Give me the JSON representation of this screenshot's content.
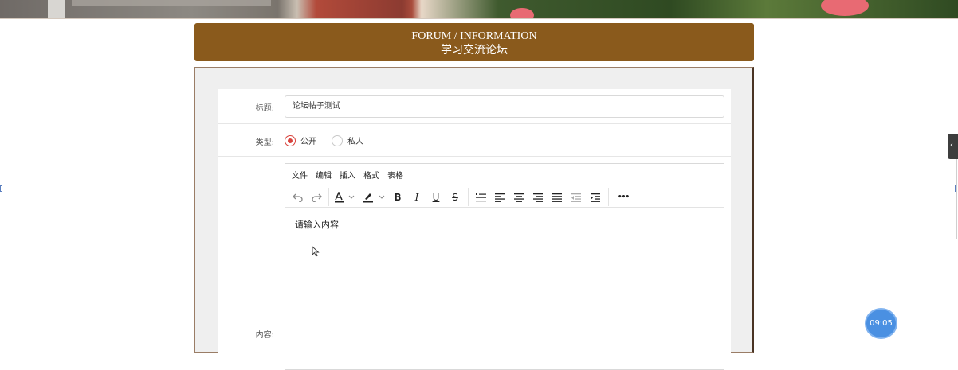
{
  "header": {
    "title_en": "FORUM / INFORMATION",
    "title_cn": "学习交流论坛"
  },
  "form": {
    "title_label": "标题:",
    "title_value": "论坛帖子测试",
    "type_label": "类型:",
    "type_options": [
      {
        "label": "公开",
        "selected": true
      },
      {
        "label": "私人",
        "selected": false
      }
    ],
    "content_label": "内容:"
  },
  "editor": {
    "menu": [
      "文件",
      "编辑",
      "插入",
      "格式",
      "表格"
    ],
    "toolbar_icons": [
      "undo-icon",
      "redo-icon",
      "text-color-icon",
      "highlight-icon",
      "bold-icon",
      "italic-icon",
      "underline-icon",
      "strikethrough-icon",
      "list-icon",
      "align-left-icon",
      "align-center-icon",
      "align-right-icon",
      "justify-icon",
      "outdent-icon",
      "indent-icon",
      "more-icon"
    ],
    "bold_glyph": "B",
    "italic_glyph": "I",
    "underline_glyph": "U",
    "strike_glyph": "S",
    "more_glyph": "•••",
    "placeholder": "请输入内容"
  },
  "timer": "09:05",
  "colors": {
    "header_bg": "#8a5a1c",
    "radio_active": "#d8433d",
    "timer_bg": "#4a90e2"
  }
}
